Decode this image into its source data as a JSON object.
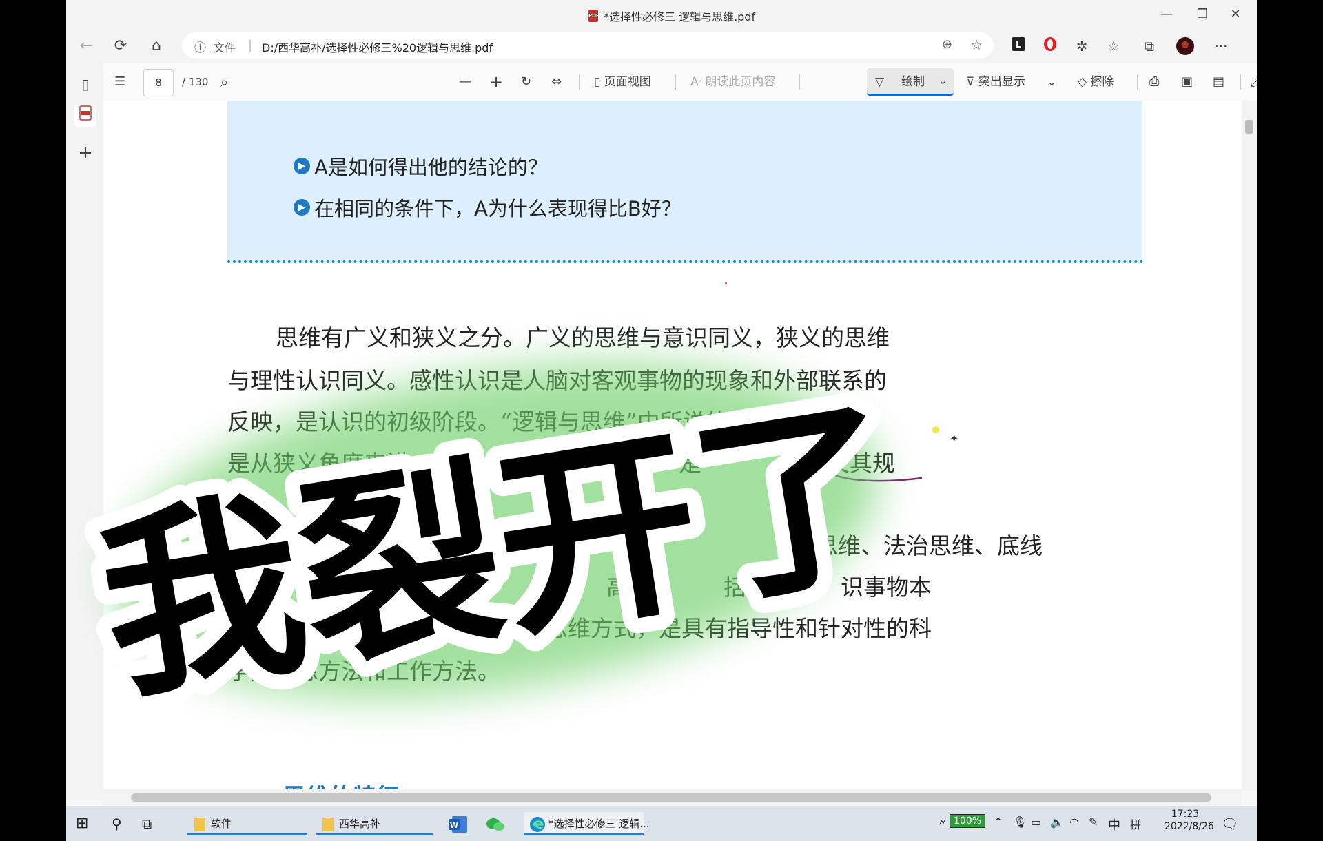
{
  "window": {
    "title": "*选择性必修三 逻辑与思维.pdf",
    "pdf_badge": "PDF",
    "minimize": "—",
    "restore": "❐",
    "close": "✕"
  },
  "address_bar": {
    "info_icon": "ⓘ",
    "file_label": "文件",
    "separator": "|",
    "url": "D:/西华高补/选择性必修三%20逻辑与思维.pdf",
    "zoom_icon": "⊕",
    "favorite_icon": "☆"
  },
  "nav": {
    "back": "←",
    "refresh": "⟳",
    "home": "⌂",
    "more": "···"
  },
  "pdf_toolbar": {
    "toc_icon": "☰",
    "page_current": "8",
    "page_total": "/ 130",
    "search_icon": "⌕",
    "zoom_out": "—",
    "zoom_in": "+",
    "rotate_icon": "↻",
    "fit_icon": "⇔",
    "page_view": "页面视图",
    "read_aloud": "朗读此页内容",
    "draw": "绘制",
    "highlight": "突出显示",
    "erase": "擦除",
    "dropdown": "⌄"
  },
  "document": {
    "questions": [
      "A是如何得出他的结论的？",
      "在相同的条件下，A为什么表现得比B好？"
    ],
    "paragraph_lines": [
      "思维有广义和狭义之分。广义的思维与意识同义，狭义的思维",
      "与理性认识同义。感性认识是人脑对客观事物的现象和外部联系的",
      "反映，是认识的初级阶段。“逻辑与思维”中所说的“思维”主要",
      "是从狭义角度来讲",
      "",
      "新思维、法治思维、底线",
      "是",
      "物发展的重要的思维方式，是具有指导性和针对性的科",
      "学的思想方法和工作方法。"
    ],
    "partial_line_right": "是",
    "partial_line_right2": "及其规",
    "line6_mid": "高",
    "line6_right": "括，是",
    "line6_right2": "识事物本",
    "subheading": "思维的特征"
  },
  "overlay": {
    "sticker_text": "我裂开了"
  },
  "taskbar": {
    "start": "⊞",
    "search": "⚲",
    "taskview": "⧉",
    "items": [
      {
        "label": "软件"
      },
      {
        "label": "西华高补"
      },
      {
        "label": ""
      },
      {
        "label": ""
      },
      {
        "label": "*选择性必修三 逻辑..."
      }
    ],
    "battery": "100%",
    "ime": "中",
    "ime2": "拼",
    "time": "17:23",
    "date": "2022/8/26"
  }
}
